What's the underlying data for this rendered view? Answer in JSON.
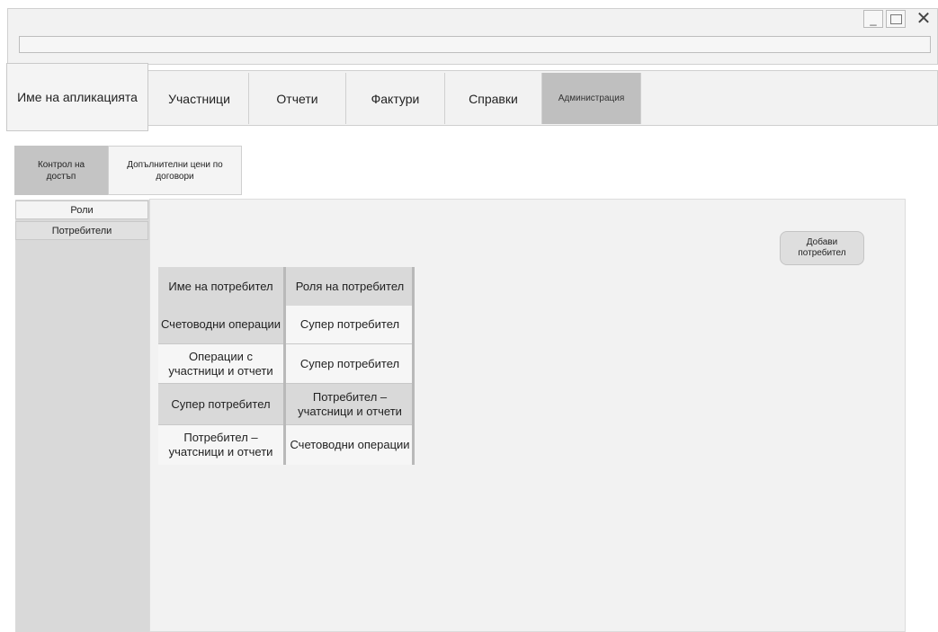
{
  "window": {
    "minimize_glyph": "_",
    "close_glyph": "✕"
  },
  "app": {
    "name": "Име на апликацията"
  },
  "menu": {
    "items": [
      {
        "label": "Участници"
      },
      {
        "label": "Отчети"
      },
      {
        "label": "Фактури"
      },
      {
        "label": "Справки"
      },
      {
        "label": "Администрация",
        "active": true
      }
    ]
  },
  "subtabs": [
    {
      "label": "Контрол на достъп",
      "active": true
    },
    {
      "label": "Допълнителни цени по договори",
      "active": false
    }
  ],
  "sidebar": {
    "items": [
      {
        "label": "Роли"
      },
      {
        "label": "Потребители"
      }
    ]
  },
  "actions": {
    "add_user_label": "Добави потребител"
  },
  "table": {
    "headers": [
      "Име на потребител",
      "Роля на потребител"
    ],
    "rows": [
      [
        "Счетоводни операции",
        "Супер потребител"
      ],
      [
        "Операции с участници и отчети",
        "Супер потребител"
      ],
      [
        "Супер потребител",
        "Потребител – учатсници и отчети"
      ],
      [
        "Потребител – учатсници и отчети",
        "Счетоводни операции"
      ]
    ]
  },
  "colors": {
    "active_tab": "#bfbfbf",
    "sidebar": "#d9d9d9",
    "panel": "#f2f2f2"
  }
}
